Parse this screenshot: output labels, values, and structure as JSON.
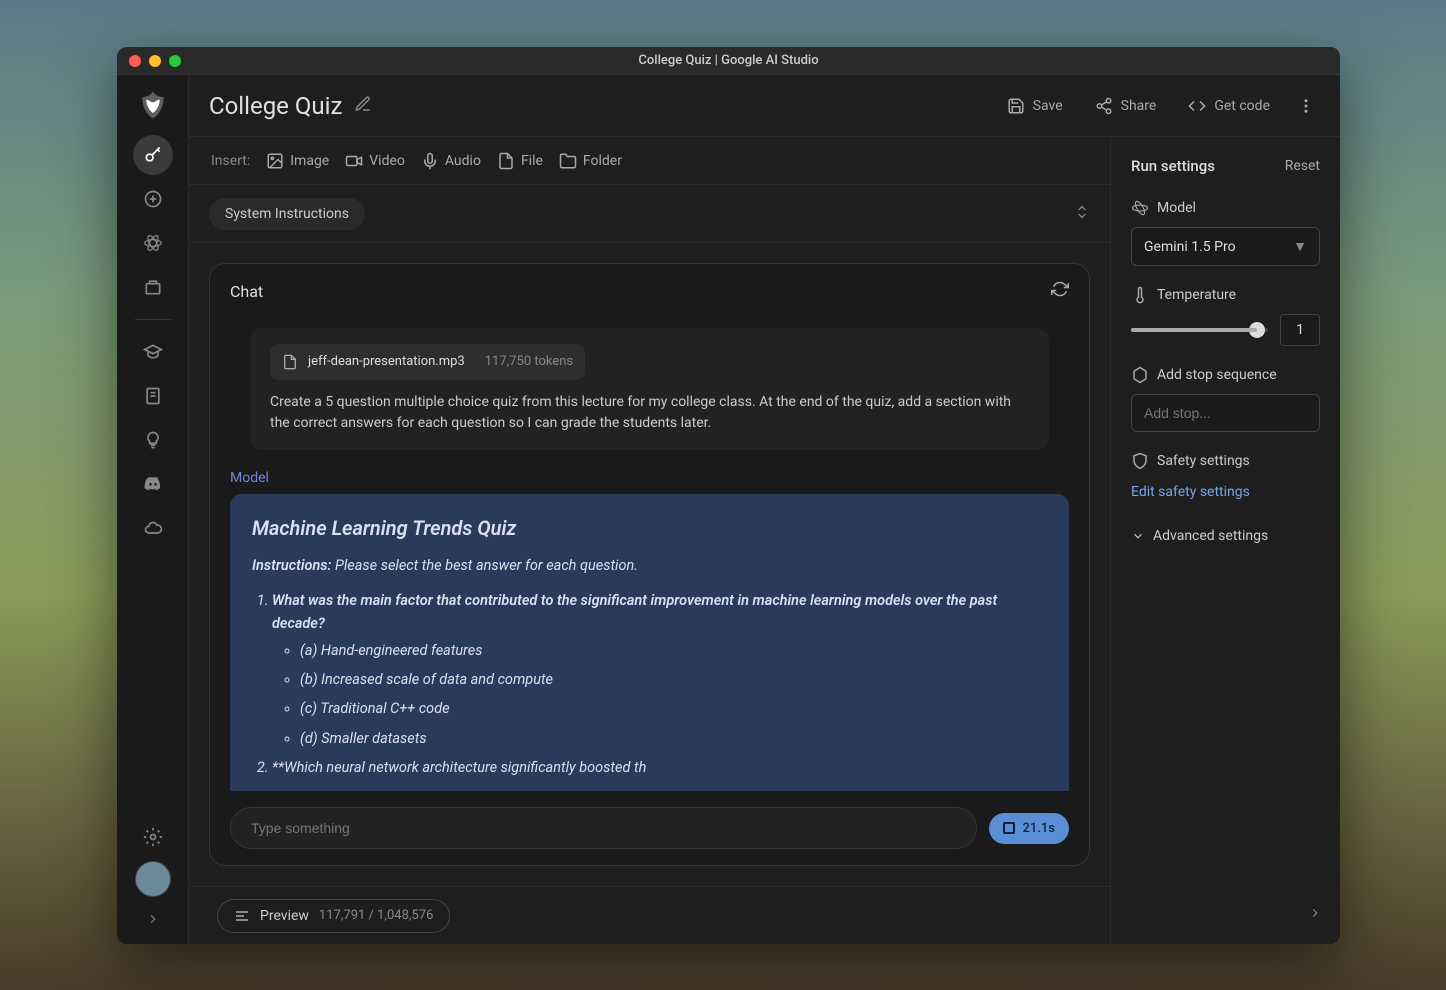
{
  "window": {
    "title": "College Quiz | Google AI Studio"
  },
  "topbar": {
    "page_title": "College Quiz",
    "save": "Save",
    "share": "Share",
    "get_code": "Get code"
  },
  "insert": {
    "label": "Insert:",
    "image": "Image",
    "video": "Video",
    "audio": "Audio",
    "file": "File",
    "folder": "Folder"
  },
  "system_instructions": {
    "label": "System Instructions"
  },
  "chat": {
    "title": "Chat",
    "file": {
      "name": "jeff-dean-presentation.mp3",
      "tokens": "117,750 tokens"
    },
    "user_prompt": "Create a 5 question multiple choice quiz from this lecture for my college class. At the end of the quiz, add a section with the correct answers for each question so I can grade the students later.",
    "model_label": "Model",
    "response": {
      "title": "Machine Learning Trends Quiz",
      "instructions_label": "Instructions:",
      "instructions_text": "Please select the best answer for each question.",
      "q1": {
        "text": "What was the main factor that contributed to the significant improvement in machine learning models over the past decade?",
        "a": "(a) Hand-engineered features",
        "b": "(b) Increased scale of data and compute",
        "c": "(c) Traditional C++ code",
        "d": "(d) Smaller datasets"
      },
      "q2_partial": "**Which neural network architecture significantly boosted th"
    },
    "input_placeholder": "Type something",
    "stop_time": "21.1s"
  },
  "preview": {
    "label": "Preview",
    "tokens": "117,791 / 1,048,576"
  },
  "settings": {
    "title": "Run settings",
    "reset": "Reset",
    "model_label": "Model",
    "model_selected": "Gemini 1.5 Pro",
    "temperature_label": "Temperature",
    "temperature_value": "1",
    "stop_sequence_label": "Add stop sequence",
    "stop_placeholder": "Add stop...",
    "safety_label": "Safety settings",
    "safety_link": "Edit safety settings",
    "advanced_label": "Advanced settings"
  }
}
